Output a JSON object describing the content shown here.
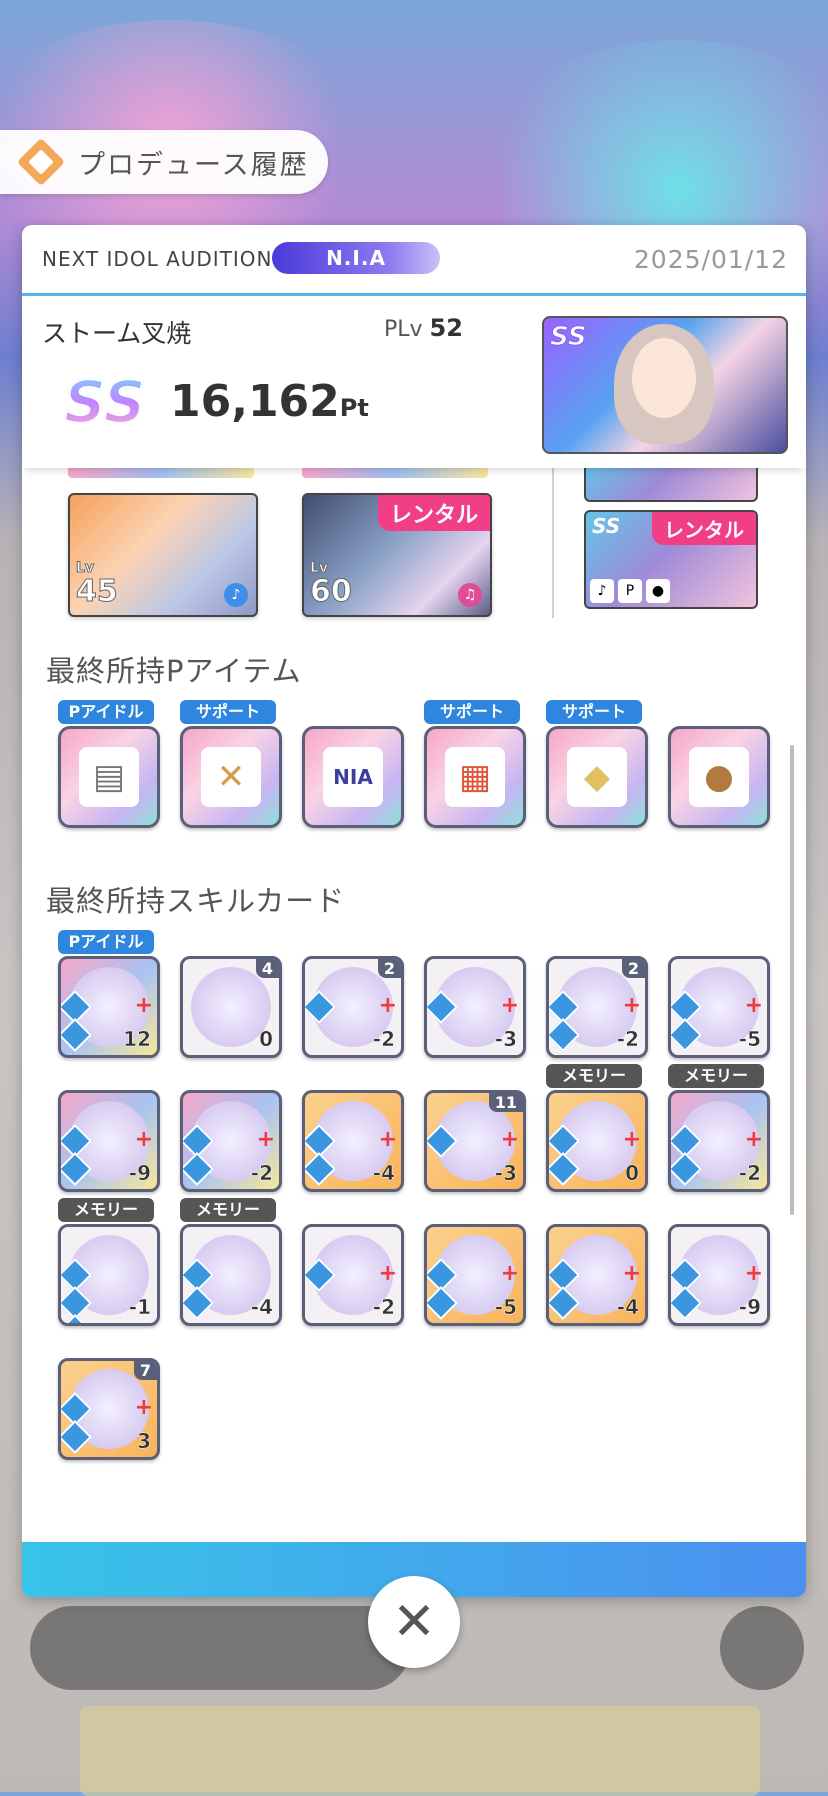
{
  "header": {
    "title": "プロデュース履歴"
  },
  "panel": {
    "audition_label": "NEXT IDOL AUDITION",
    "audition_badge": "N.I.A",
    "date": "2025/01/12",
    "producer_name": "ストーム叉焼",
    "plv_label": "PLv",
    "plv_value": "52",
    "rank": "SS",
    "score": "16,162",
    "score_unit": "Pt"
  },
  "support_cards": [
    {
      "lv_label": "Lv",
      "lv": "45",
      "rental": ""
    },
    {
      "lv_label": "Lv",
      "lv": "60",
      "rental": "レンタル"
    }
  ],
  "mini_cards": [
    {
      "rank": "SS",
      "rental": "レンタル"
    }
  ],
  "sections": {
    "p_items_title": "最終所持Pアイテム",
    "skill_cards_title": "最終所持スキルカード"
  },
  "p_item_tags": [
    "Pアイドル",
    "サポート",
    "サポート",
    "サポート"
  ],
  "p_items": [
    {
      "icon": "tablet-icon"
    },
    {
      "icon": "wood-icon"
    },
    {
      "icon": "nia-emblem-icon"
    },
    {
      "icon": "ramen-icon"
    },
    {
      "icon": "towel-icon"
    },
    {
      "icon": "bag-icon"
    }
  ],
  "skill_tags": {
    "p_idol": "Pアイドル",
    "memory": "メモリー"
  },
  "skill_cards": [
    {
      "cost": "12",
      "level": ""
    },
    {
      "cost": "0",
      "level": "4"
    },
    {
      "cost": "-2",
      "level": "2"
    },
    {
      "cost": "-3",
      "level": ""
    },
    {
      "cost": "-2",
      "level": "2"
    },
    {
      "cost": "-5",
      "level": ""
    },
    {
      "cost": "-9",
      "level": ""
    },
    {
      "cost": "-2",
      "level": ""
    },
    {
      "cost": "-4",
      "level": ""
    },
    {
      "cost": "-3",
      "level": "11"
    },
    {
      "cost": "0",
      "level": ""
    },
    {
      "cost": "-2",
      "level": ""
    },
    {
      "cost": "-1",
      "level": ""
    },
    {
      "cost": "-4",
      "level": ""
    },
    {
      "cost": "-2",
      "level": ""
    },
    {
      "cost": "-5",
      "level": ""
    },
    {
      "cost": "-4",
      "level": ""
    },
    {
      "cost": "-9",
      "level": ""
    },
    {
      "cost": "3",
      "level": "7"
    }
  ],
  "close_label": "✕"
}
